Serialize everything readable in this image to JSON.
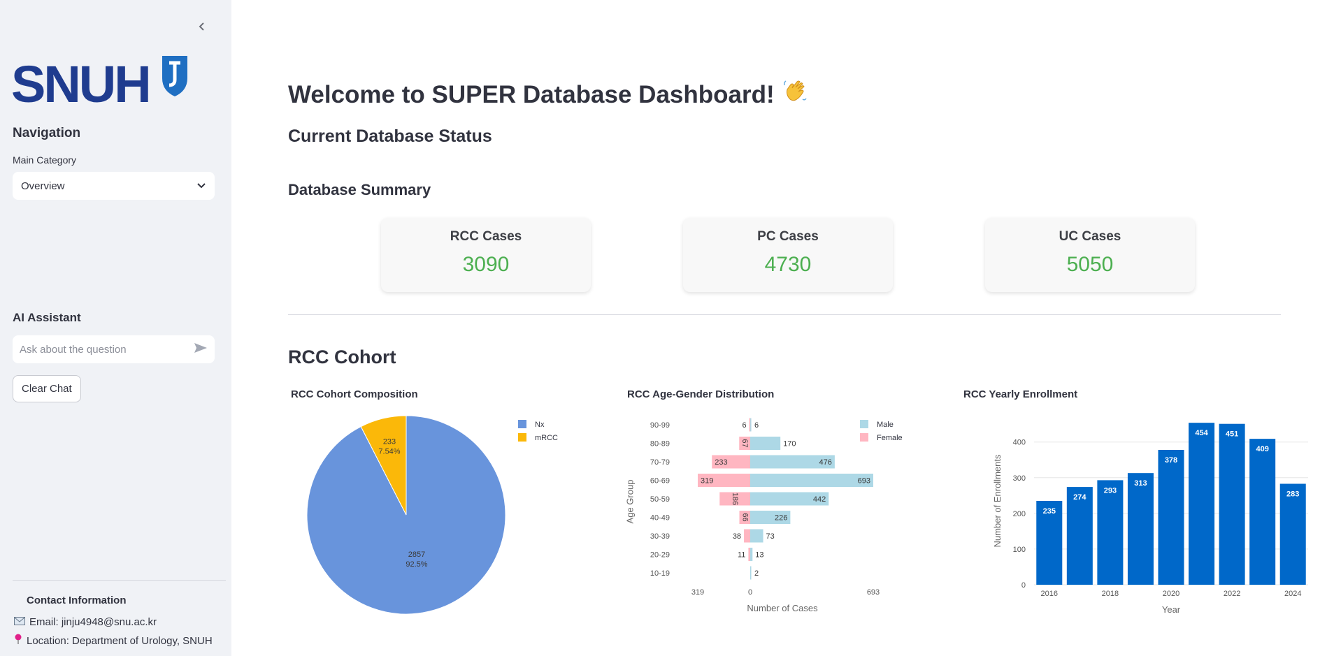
{
  "sidebar": {
    "collapse_icon": "chevron-left-icon",
    "logo_text": "SNUH",
    "navigation_heading": "Navigation",
    "main_category_label": "Main Category",
    "main_category_value": "Overview",
    "ai_heading": "AI Assistant",
    "ai_placeholder": "Ask about the question",
    "clear_chat_label": "Clear Chat",
    "contact_heading": "Contact Information",
    "email_text": "Email: jinju4948@snu.ac.kr",
    "location_text": "Location: Department of Urology, SNUH"
  },
  "main": {
    "title": "Welcome to SUPER Database Dashboard!",
    "status_heading": "Current Database Status",
    "summary_heading": "Database Summary",
    "metrics": [
      {
        "label": "RCC Cases",
        "value": "3090"
      },
      {
        "label": "PC Cases",
        "value": "4730"
      },
      {
        "label": "UC Cases",
        "value": "5050"
      }
    ],
    "cohort_heading": "RCC Cohort"
  },
  "colors": {
    "accent_green": "#4caf50",
    "pie_nx": "#6894dc",
    "pie_mrcc": "#fbb809",
    "male": "#add8e6",
    "female": "#ffb6c1",
    "bar": "#0068c9"
  },
  "chart_data": [
    {
      "type": "pie",
      "title": "RCC Cohort Composition",
      "labels": [
        "Nx",
        "mRCC"
      ],
      "values": [
        2857,
        233
      ],
      "percent_labels": [
        "92.5%",
        "7.54%"
      ],
      "legend": "top-right"
    },
    {
      "type": "bar",
      "orientation": "horizontal",
      "title": "RCC Age-Gender Distribution",
      "categories": [
        "90-99",
        "80-89",
        "70-79",
        "60-69",
        "50-59",
        "40-49",
        "30-39",
        "20-29",
        "10-19"
      ],
      "series": [
        {
          "name": "Male",
          "values": [
            6,
            170,
            476,
            693,
            442,
            226,
            73,
            13,
            2
          ]
        },
        {
          "name": "Female",
          "values": [
            6,
            67,
            233,
            319,
            186,
            66,
            38,
            11,
            0
          ]
        }
      ],
      "xlabel": "Number of Cases",
      "ylabel": "Age Group",
      "x_ticks": [
        "319",
        "0",
        "693"
      ],
      "legend": "top-right"
    },
    {
      "type": "bar",
      "title": "RCC Yearly Enrollment",
      "categories": [
        "2016",
        "2017",
        "2018",
        "2019",
        "2020",
        "2021",
        "2022",
        "2023",
        "2024"
      ],
      "values": [
        235,
        274,
        293,
        313,
        378,
        454,
        451,
        409,
        283
      ],
      "xlabel": "Year",
      "ylabel": "Number of Enrollments",
      "x_ticks": [
        "2016",
        "2018",
        "2020",
        "2022",
        "2024"
      ],
      "y_ticks": [
        "0",
        "100",
        "200",
        "300",
        "400"
      ],
      "ylim": [
        0,
        470
      ],
      "grid": true
    }
  ]
}
